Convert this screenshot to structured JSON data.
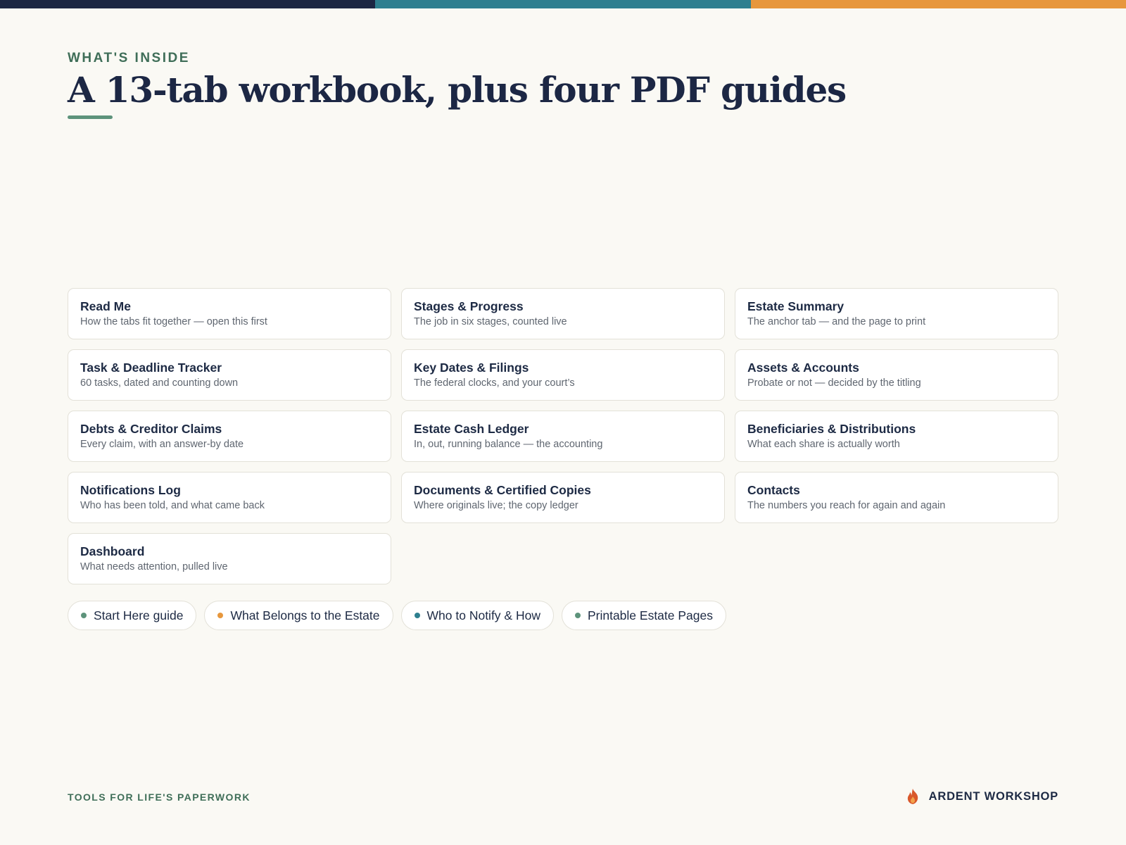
{
  "colors": {
    "bar_navy": "#1c2744",
    "bar_teal": "#2e7f8f",
    "bar_orange": "#e7973d",
    "accent_green": "#5d937b",
    "accent_orange": "#e7973d",
    "accent_teal": "#2e7f8f",
    "flame": "#d9582b"
  },
  "header": {
    "eyebrow": "WHAT'S INSIDE",
    "title": "A 13-tab workbook, plus four PDF guides"
  },
  "tabs": [
    {
      "title": "Read Me",
      "desc": "How the tabs fit together — open this first"
    },
    {
      "title": "Stages & Progress",
      "desc": "The job in six stages, counted live"
    },
    {
      "title": "Estate Summary",
      "desc": "The anchor tab — and the page to print"
    },
    {
      "title": "Task & Deadline Tracker",
      "desc": "60 tasks, dated and counting down"
    },
    {
      "title": "Key Dates & Filings",
      "desc": "The federal clocks, and your court’s"
    },
    {
      "title": "Assets & Accounts",
      "desc": "Probate or not — decided by the titling"
    },
    {
      "title": "Debts & Creditor Claims",
      "desc": "Every claim, with an answer-by date"
    },
    {
      "title": "Estate Cash Ledger",
      "desc": "In, out, running balance — the accounting"
    },
    {
      "title": "Beneficiaries & Distributions",
      "desc": "What each share is actually worth"
    },
    {
      "title": "Notifications Log",
      "desc": "Who has been told, and what came back"
    },
    {
      "title": "Documents & Certified Copies",
      "desc": "Where originals live; the copy ledger"
    },
    {
      "title": "Contacts",
      "desc": "The numbers you reach for again and again"
    },
    {
      "title": "Dashboard",
      "desc": "What needs attention, pulled live"
    }
  ],
  "guides": [
    {
      "label": "Start Here guide",
      "dot_color": "#5d937b"
    },
    {
      "label": "What Belongs to the Estate",
      "dot_color": "#e7973d"
    },
    {
      "label": "Who to Notify & How",
      "dot_color": "#2e7f8f"
    },
    {
      "label": "Printable Estate Pages",
      "dot_color": "#5d937b"
    }
  ],
  "footer": {
    "tagline": "TOOLS FOR LIFE'S PAPERWORK",
    "brand_icon": "flame-icon",
    "brand": "ARDENT WORKSHOP"
  }
}
